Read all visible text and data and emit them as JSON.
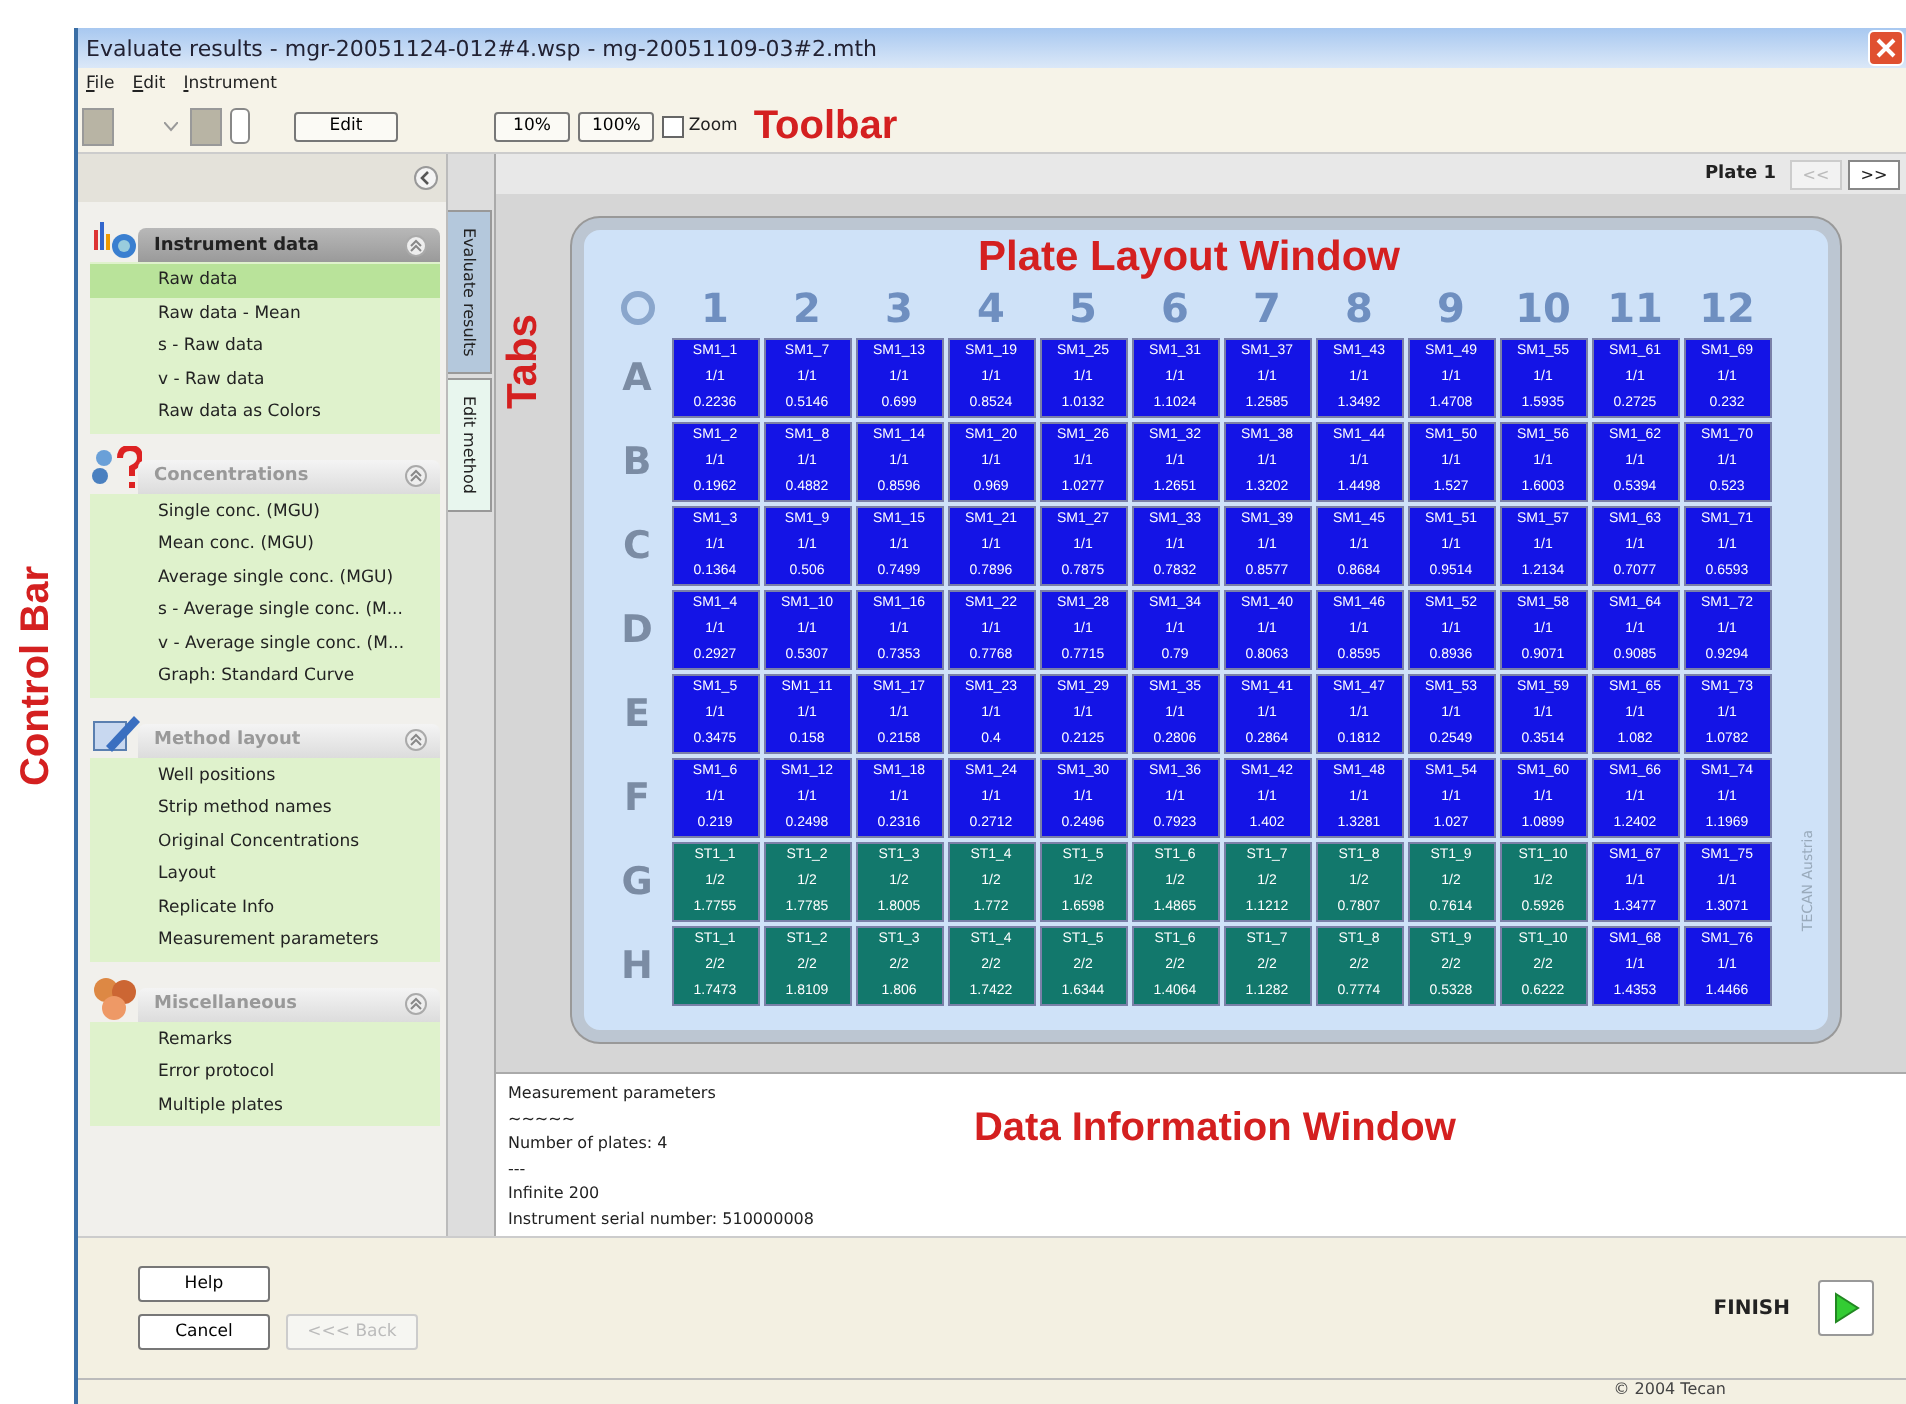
{
  "window": {
    "title": "Evaluate results - mgr-20051124-012#4.wsp - mg-20051109-03#2.mth"
  },
  "menu": [
    "File",
    "Edit",
    "Instrument"
  ],
  "toolbar": {
    "edit_button": "Edit",
    "zoom_buttons": [
      "10%",
      "100%"
    ],
    "zoom_checkbox": {
      "label": "Zoom",
      "checked": false
    }
  },
  "annotations": {
    "toolbar": "Toolbar",
    "tabs": "Tabs",
    "control_bar": "Control Bar",
    "plate_layout": "Plate Layout Window",
    "data_information": "Data Information Window"
  },
  "sidebar": {
    "groups": [
      {
        "title": "Instrument data",
        "kind": "chart",
        "selected": true,
        "expanded": true,
        "items": [
          {
            "label": "Raw data",
            "selected": true
          },
          {
            "label": "Raw data - Mean",
            "selected": false
          },
          {
            "label": "s - Raw data",
            "selected": false
          },
          {
            "label": "v - Raw data",
            "selected": false
          },
          {
            "label": "Raw data as Colors",
            "selected": false
          }
        ]
      },
      {
        "title": "Concentrations",
        "kind": "question",
        "selected": false,
        "expanded": true,
        "items": [
          {
            "label": "Single conc. (MGU)",
            "selected": false
          },
          {
            "label": "Mean conc. (MGU)",
            "selected": false
          },
          {
            "label": "Average single conc. (MGU)",
            "selected": false
          },
          {
            "label": "s - Average single conc. (M...",
            "selected": false
          },
          {
            "label": "v - Average single conc. (M...",
            "selected": false
          },
          {
            "label": "Graph: Standard Curve",
            "selected": false
          }
        ]
      },
      {
        "title": "Method layout",
        "kind": "pencil",
        "selected": false,
        "expanded": true,
        "items": [
          {
            "label": "Well positions",
            "selected": false
          },
          {
            "label": "Strip method names",
            "selected": false
          },
          {
            "label": "Original Concentrations",
            "selected": false
          },
          {
            "label": "Layout",
            "selected": false
          },
          {
            "label": "Replicate Info",
            "selected": false
          },
          {
            "label": "Measurement parameters",
            "selected": false
          }
        ]
      },
      {
        "title": "Miscellaneous",
        "kind": "cluster",
        "selected": false,
        "expanded": true,
        "items": [
          {
            "label": "Remarks",
            "selected": false
          },
          {
            "label": "Error protocol",
            "selected": false
          },
          {
            "label": "Multiple plates",
            "selected": false
          }
        ]
      }
    ]
  },
  "tabs": [
    {
      "label": "Evaluate results",
      "selected": true
    },
    {
      "label": "Edit method",
      "selected": false
    }
  ],
  "plate_nav": {
    "label": "Plate 1",
    "prev": {
      "label": "<<",
      "disabled": true
    },
    "next": {
      "label": ">>",
      "disabled": false
    }
  },
  "plate": {
    "columns": [
      "1",
      "2",
      "3",
      "4",
      "5",
      "6",
      "7",
      "8",
      "9",
      "10",
      "11",
      "12"
    ],
    "vendor_mark": "TECAN Austria",
    "rows": [
      {
        "letter": "A",
        "wells": [
          {
            "id": "SM1_1",
            "rep": "1/1",
            "value": "0.2236",
            "kind": "sample"
          },
          {
            "id": "SM1_7",
            "rep": "1/1",
            "value": "0.5146",
            "kind": "sample"
          },
          {
            "id": "SM1_13",
            "rep": "1/1",
            "value": "0.699",
            "kind": "sample"
          },
          {
            "id": "SM1_19",
            "rep": "1/1",
            "value": "0.8524",
            "kind": "sample"
          },
          {
            "id": "SM1_25",
            "rep": "1/1",
            "value": "1.0132",
            "kind": "sample"
          },
          {
            "id": "SM1_31",
            "rep": "1/1",
            "value": "1.1024",
            "kind": "sample"
          },
          {
            "id": "SM1_37",
            "rep": "1/1",
            "value": "1.2585",
            "kind": "sample"
          },
          {
            "id": "SM1_43",
            "rep": "1/1",
            "value": "1.3492",
            "kind": "sample"
          },
          {
            "id": "SM1_49",
            "rep": "1/1",
            "value": "1.4708",
            "kind": "sample"
          },
          {
            "id": "SM1_55",
            "rep": "1/1",
            "value": "1.5935",
            "kind": "sample"
          },
          {
            "id": "SM1_61",
            "rep": "1/1",
            "value": "0.2725",
            "kind": "sample"
          },
          {
            "id": "SM1_69",
            "rep": "1/1",
            "value": "0.232",
            "kind": "sample"
          }
        ]
      },
      {
        "letter": "B",
        "wells": [
          {
            "id": "SM1_2",
            "rep": "1/1",
            "value": "0.1962",
            "kind": "sample"
          },
          {
            "id": "SM1_8",
            "rep": "1/1",
            "value": "0.4882",
            "kind": "sample"
          },
          {
            "id": "SM1_14",
            "rep": "1/1",
            "value": "0.8596",
            "kind": "sample"
          },
          {
            "id": "SM1_20",
            "rep": "1/1",
            "value": "0.969",
            "kind": "sample"
          },
          {
            "id": "SM1_26",
            "rep": "1/1",
            "value": "1.0277",
            "kind": "sample"
          },
          {
            "id": "SM1_32",
            "rep": "1/1",
            "value": "1.2651",
            "kind": "sample"
          },
          {
            "id": "SM1_38",
            "rep": "1/1",
            "value": "1.3202",
            "kind": "sample"
          },
          {
            "id": "SM1_44",
            "rep": "1/1",
            "value": "1.4498",
            "kind": "sample"
          },
          {
            "id": "SM1_50",
            "rep": "1/1",
            "value": "1.527",
            "kind": "sample"
          },
          {
            "id": "SM1_56",
            "rep": "1/1",
            "value": "1.6003",
            "kind": "sample"
          },
          {
            "id": "SM1_62",
            "rep": "1/1",
            "value": "0.5394",
            "kind": "sample"
          },
          {
            "id": "SM1_70",
            "rep": "1/1",
            "value": "0.523",
            "kind": "sample"
          }
        ]
      },
      {
        "letter": "C",
        "wells": [
          {
            "id": "SM1_3",
            "rep": "1/1",
            "value": "0.1364",
            "kind": "sample"
          },
          {
            "id": "SM1_9",
            "rep": "1/1",
            "value": "0.506",
            "kind": "sample"
          },
          {
            "id": "SM1_15",
            "rep": "1/1",
            "value": "0.7499",
            "kind": "sample"
          },
          {
            "id": "SM1_21",
            "rep": "1/1",
            "value": "0.7896",
            "kind": "sample"
          },
          {
            "id": "SM1_27",
            "rep": "1/1",
            "value": "0.7875",
            "kind": "sample"
          },
          {
            "id": "SM1_33",
            "rep": "1/1",
            "value": "0.7832",
            "kind": "sample"
          },
          {
            "id": "SM1_39",
            "rep": "1/1",
            "value": "0.8577",
            "kind": "sample"
          },
          {
            "id": "SM1_45",
            "rep": "1/1",
            "value": "0.8684",
            "kind": "sample"
          },
          {
            "id": "SM1_51",
            "rep": "1/1",
            "value": "0.9514",
            "kind": "sample"
          },
          {
            "id": "SM1_57",
            "rep": "1/1",
            "value": "1.2134",
            "kind": "sample"
          },
          {
            "id": "SM1_63",
            "rep": "1/1",
            "value": "0.7077",
            "kind": "sample"
          },
          {
            "id": "SM1_71",
            "rep": "1/1",
            "value": "0.6593",
            "kind": "sample"
          }
        ]
      },
      {
        "letter": "D",
        "wells": [
          {
            "id": "SM1_4",
            "rep": "1/1",
            "value": "0.2927",
            "kind": "sample"
          },
          {
            "id": "SM1_10",
            "rep": "1/1",
            "value": "0.5307",
            "kind": "sample"
          },
          {
            "id": "SM1_16",
            "rep": "1/1",
            "value": "0.7353",
            "kind": "sample"
          },
          {
            "id": "SM1_22",
            "rep": "1/1",
            "value": "0.7768",
            "kind": "sample"
          },
          {
            "id": "SM1_28",
            "rep": "1/1",
            "value": "0.7715",
            "kind": "sample"
          },
          {
            "id": "SM1_34",
            "rep": "1/1",
            "value": "0.79",
            "kind": "sample"
          },
          {
            "id": "SM1_40",
            "rep": "1/1",
            "value": "0.8063",
            "kind": "sample"
          },
          {
            "id": "SM1_46",
            "rep": "1/1",
            "value": "0.8595",
            "kind": "sample"
          },
          {
            "id": "SM1_52",
            "rep": "1/1",
            "value": "0.8936",
            "kind": "sample"
          },
          {
            "id": "SM1_58",
            "rep": "1/1",
            "value": "0.9071",
            "kind": "sample"
          },
          {
            "id": "SM1_64",
            "rep": "1/1",
            "value": "0.9085",
            "kind": "sample"
          },
          {
            "id": "SM1_72",
            "rep": "1/1",
            "value": "0.9294",
            "kind": "sample"
          }
        ]
      },
      {
        "letter": "E",
        "wells": [
          {
            "id": "SM1_5",
            "rep": "1/1",
            "value": "0.3475",
            "kind": "sample"
          },
          {
            "id": "SM1_11",
            "rep": "1/1",
            "value": "0.158",
            "kind": "sample"
          },
          {
            "id": "SM1_17",
            "rep": "1/1",
            "value": "0.2158",
            "kind": "sample"
          },
          {
            "id": "SM1_23",
            "rep": "1/1",
            "value": "0.4",
            "kind": "sample"
          },
          {
            "id": "SM1_29",
            "rep": "1/1",
            "value": "0.2125",
            "kind": "sample"
          },
          {
            "id": "SM1_35",
            "rep": "1/1",
            "value": "0.2806",
            "kind": "sample"
          },
          {
            "id": "SM1_41",
            "rep": "1/1",
            "value": "0.2864",
            "kind": "sample"
          },
          {
            "id": "SM1_47",
            "rep": "1/1",
            "value": "0.1812",
            "kind": "sample"
          },
          {
            "id": "SM1_53",
            "rep": "1/1",
            "value": "0.2549",
            "kind": "sample"
          },
          {
            "id": "SM1_59",
            "rep": "1/1",
            "value": "0.3514",
            "kind": "sample"
          },
          {
            "id": "SM1_65",
            "rep": "1/1",
            "value": "1.082",
            "kind": "sample"
          },
          {
            "id": "SM1_73",
            "rep": "1/1",
            "value": "1.0782",
            "kind": "sample"
          }
        ]
      },
      {
        "letter": "F",
        "wells": [
          {
            "id": "SM1_6",
            "rep": "1/1",
            "value": "0.219",
            "kind": "sample"
          },
          {
            "id": "SM1_12",
            "rep": "1/1",
            "value": "0.2498",
            "kind": "sample"
          },
          {
            "id": "SM1_18",
            "rep": "1/1",
            "value": "0.2316",
            "kind": "sample"
          },
          {
            "id": "SM1_24",
            "rep": "1/1",
            "value": "0.2712",
            "kind": "sample"
          },
          {
            "id": "SM1_30",
            "rep": "1/1",
            "value": "0.2496",
            "kind": "sample"
          },
          {
            "id": "SM1_36",
            "rep": "1/1",
            "value": "0.7923",
            "kind": "sample"
          },
          {
            "id": "SM1_42",
            "rep": "1/1",
            "value": "1.402",
            "kind": "sample"
          },
          {
            "id": "SM1_48",
            "rep": "1/1",
            "value": "1.3281",
            "kind": "sample"
          },
          {
            "id": "SM1_54",
            "rep": "1/1",
            "value": "1.027",
            "kind": "sample"
          },
          {
            "id": "SM1_60",
            "rep": "1/1",
            "value": "1.0899",
            "kind": "sample"
          },
          {
            "id": "SM1_66",
            "rep": "1/1",
            "value": "1.2402",
            "kind": "sample"
          },
          {
            "id": "SM1_74",
            "rep": "1/1",
            "value": "1.1969",
            "kind": "sample"
          }
        ]
      },
      {
        "letter": "G",
        "wells": [
          {
            "id": "ST1_1",
            "rep": "1/2",
            "value": "1.7755",
            "kind": "standard"
          },
          {
            "id": "ST1_2",
            "rep": "1/2",
            "value": "1.7785",
            "kind": "standard"
          },
          {
            "id": "ST1_3",
            "rep": "1/2",
            "value": "1.8005",
            "kind": "standard"
          },
          {
            "id": "ST1_4",
            "rep": "1/2",
            "value": "1.772",
            "kind": "standard"
          },
          {
            "id": "ST1_5",
            "rep": "1/2",
            "value": "1.6598",
            "kind": "standard"
          },
          {
            "id": "ST1_6",
            "rep": "1/2",
            "value": "1.4865",
            "kind": "standard"
          },
          {
            "id": "ST1_7",
            "rep": "1/2",
            "value": "1.1212",
            "kind": "standard"
          },
          {
            "id": "ST1_8",
            "rep": "1/2",
            "value": "0.7807",
            "kind": "standard"
          },
          {
            "id": "ST1_9",
            "rep": "1/2",
            "value": "0.7614",
            "kind": "standard"
          },
          {
            "id": "ST1_10",
            "rep": "1/2",
            "value": "0.5926",
            "kind": "standard"
          },
          {
            "id": "SM1_67",
            "rep": "1/1",
            "value": "1.3477",
            "kind": "sample"
          },
          {
            "id": "SM1_75",
            "rep": "1/1",
            "value": "1.3071",
            "kind": "sample"
          }
        ]
      },
      {
        "letter": "H",
        "wells": [
          {
            "id": "ST1_1",
            "rep": "2/2",
            "value": "1.7473",
            "kind": "standard"
          },
          {
            "id": "ST1_2",
            "rep": "2/2",
            "value": "1.8109",
            "kind": "standard"
          },
          {
            "id": "ST1_3",
            "rep": "2/2",
            "value": "1.806",
            "kind": "standard"
          },
          {
            "id": "ST1_4",
            "rep": "2/2",
            "value": "1.7422",
            "kind": "standard"
          },
          {
            "id": "ST1_5",
            "rep": "2/2",
            "value": "1.6344",
            "kind": "standard"
          },
          {
            "id": "ST1_6",
            "rep": "2/2",
            "value": "1.4064",
            "kind": "standard"
          },
          {
            "id": "ST1_7",
            "rep": "2/2",
            "value": "1.1282",
            "kind": "standard"
          },
          {
            "id": "ST1_8",
            "rep": "2/2",
            "value": "0.7774",
            "kind": "standard"
          },
          {
            "id": "ST1_9",
            "rep": "2/2",
            "value": "0.5328",
            "kind": "standard"
          },
          {
            "id": "ST1_10",
            "rep": "2/2",
            "value": "0.6222",
            "kind": "standard"
          },
          {
            "id": "SM1_68",
            "rep": "1/1",
            "value": "1.4353",
            "kind": "sample"
          },
          {
            "id": "SM1_76",
            "rep": "1/1",
            "value": "1.4466",
            "kind": "sample"
          }
        ]
      }
    ]
  },
  "data_information": [
    "Measurement parameters",
    "~~~~~",
    "Number of plates: 4",
    "---",
    "Infinite 200",
    "Instrument serial number: 510000008"
  ],
  "buttons": {
    "help": "Help",
    "cancel": "Cancel",
    "back": {
      "label": "<<< Back",
      "disabled": true
    },
    "finish": "FINISH"
  },
  "status_bar": "© 2004 Tecan"
}
